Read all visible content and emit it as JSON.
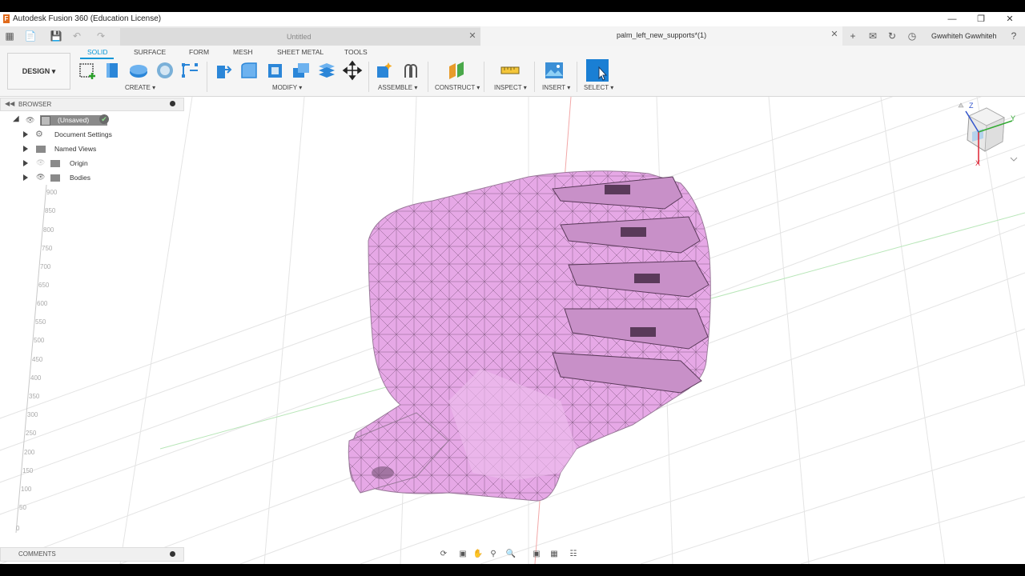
{
  "window": {
    "title": "Autodesk Fusion 360 (Education License)",
    "logo": "F"
  },
  "tabs": {
    "untitled": "Untitled",
    "active": "palm_left_new_supports*(1)"
  },
  "user": {
    "name": "Gwwhiteh Gwwhiteh"
  },
  "workspace": {
    "label": "DESIGN ▾"
  },
  "toolbar_tabs": [
    "SOLID",
    "SURFACE",
    "FORM",
    "MESH",
    "SHEET METAL",
    "TOOLS"
  ],
  "groups": {
    "create": "CREATE ▾",
    "modify": "MODIFY ▾",
    "assemble": "ASSEMBLE ▾",
    "construct": "CONSTRUCT ▾",
    "inspect": "INSPECT ▾",
    "insert": "INSERT ▾",
    "select": "SELECT ▾"
  },
  "browser": {
    "header": "BROWSER",
    "root": "(Unsaved)",
    "items": [
      "Document Settings",
      "Named Views",
      "Origin",
      "Bodies"
    ]
  },
  "comments": {
    "label": "COMMENTS"
  },
  "scale_labels": [
    "900",
    "850",
    "800",
    "750",
    "700",
    "650",
    "600",
    "550",
    "500",
    "450",
    "400",
    "350",
    "300",
    "250",
    "200",
    "150",
    "100",
    "50",
    "0"
  ],
  "viewcube": {
    "axis_x": "X",
    "axis_y": "Y",
    "axis_z": "Z"
  },
  "colors": {
    "accent": "#0696d7",
    "model_fill": "#e6a8e6",
    "model_edge": "#6a4a6a"
  }
}
